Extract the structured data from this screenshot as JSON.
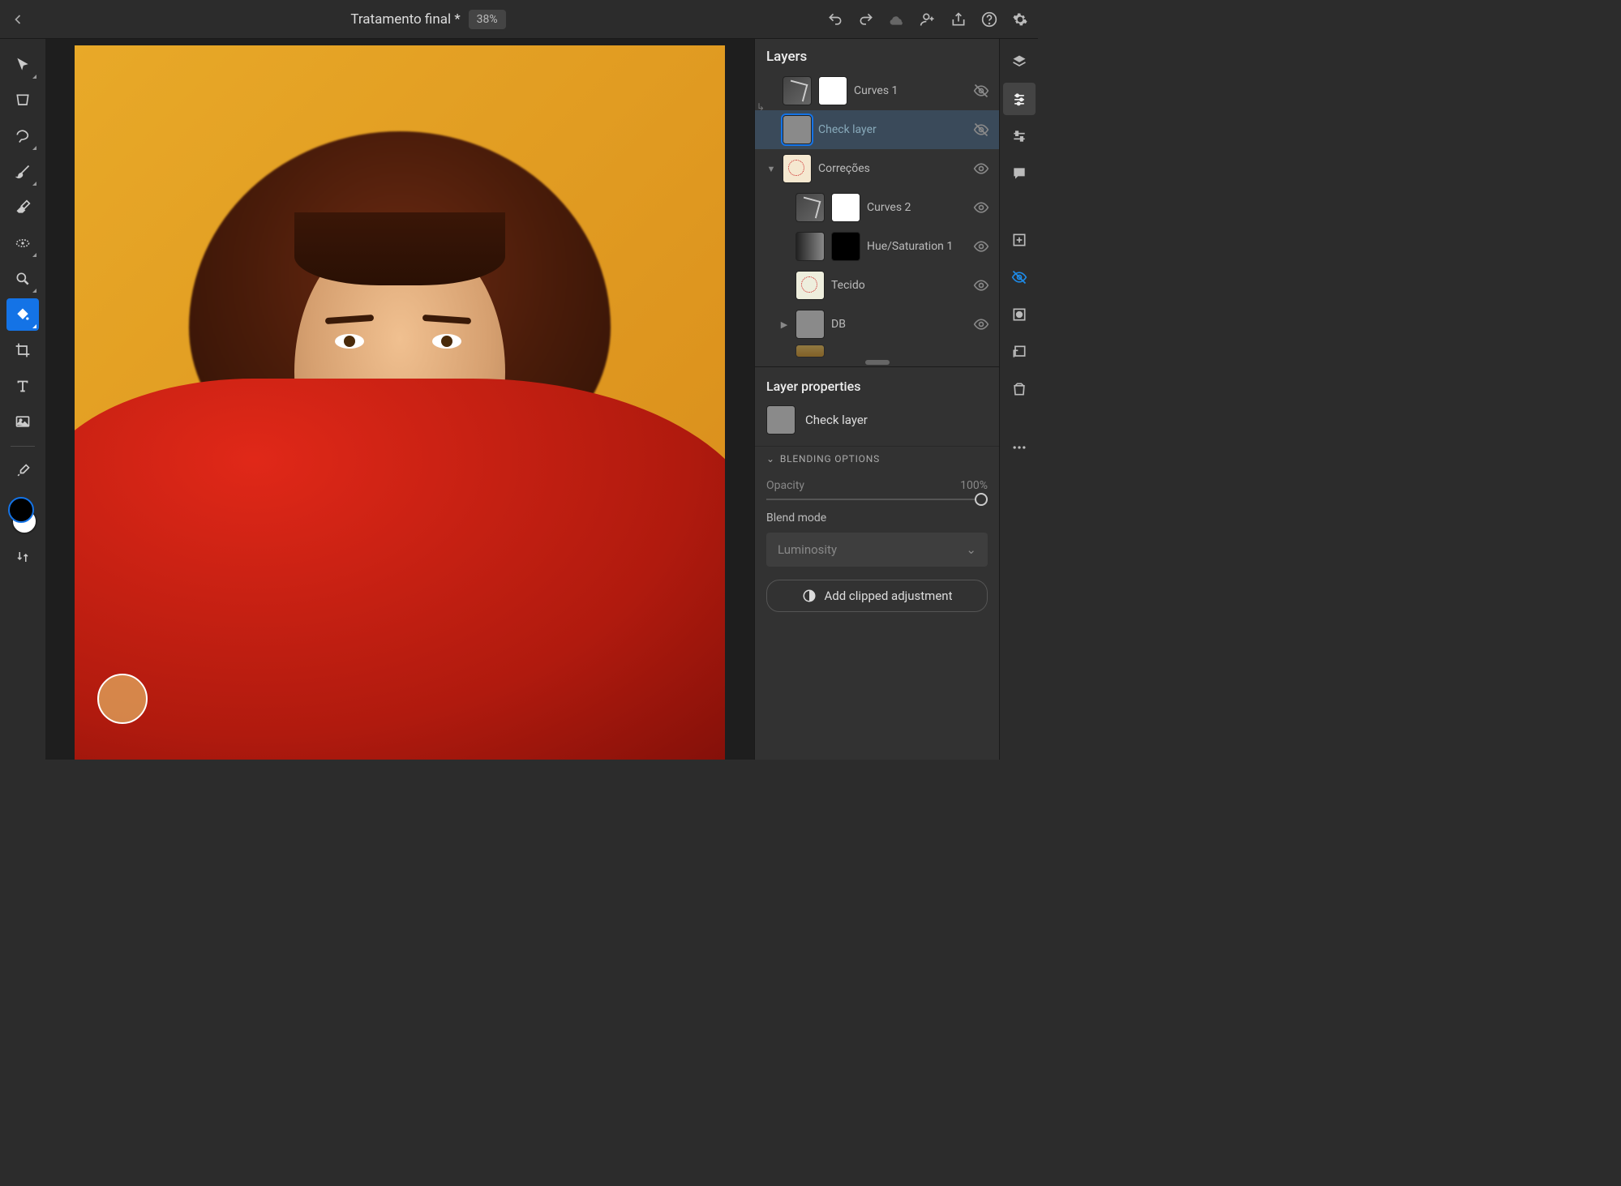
{
  "header": {
    "doc_title": "Tratamento final *",
    "zoom": "38%"
  },
  "layers": {
    "title": "Layers",
    "items": [
      {
        "name": "Curves 1",
        "visible": false,
        "clipped": true,
        "type": "curves-mask",
        "indent": 0
      },
      {
        "name": "Check layer",
        "visible": false,
        "selected": true,
        "type": "grey",
        "indent": 0
      },
      {
        "name": "Correções",
        "visible": true,
        "group": true,
        "expanded": true,
        "indent": 0
      },
      {
        "name": "Curves 2",
        "visible": true,
        "type": "curves-mask",
        "indent": 1
      },
      {
        "name": "Hue/Saturation 1",
        "visible": true,
        "type": "gradient-black",
        "indent": 1
      },
      {
        "name": "Tecido",
        "visible": true,
        "type": "tecido",
        "indent": 1
      },
      {
        "name": "DB",
        "visible": true,
        "group": true,
        "expanded": false,
        "indent": 1
      }
    ]
  },
  "props": {
    "title": "Layer properties",
    "layer_name": "Check layer",
    "blending_header": "BLENDING OPTIONS",
    "opacity_label": "Opacity",
    "opacity_value": "100%",
    "blend_mode_label": "Blend mode",
    "blend_mode_value": "Luminosity",
    "add_clipped": "Add clipped adjustment"
  }
}
